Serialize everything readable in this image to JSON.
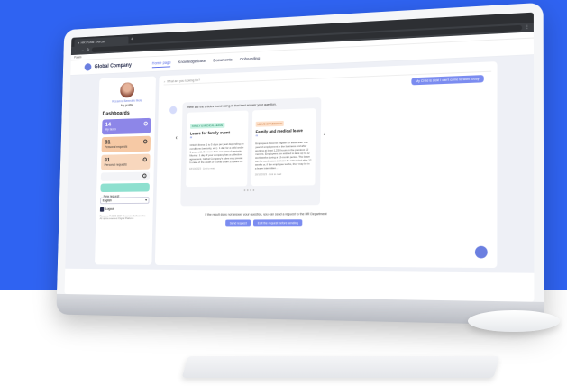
{
  "browser": {
    "tab_title": "HR Portal - Aircall",
    "url": "",
    "bookmarks_label": "Pages"
  },
  "header": {
    "company": "Global Company",
    "nav": [
      "Home page",
      "Knowledge base",
      "Documents",
      "Onboarding"
    ]
  },
  "sidebar": {
    "user_name": "Rosanna Benedek Mele",
    "profile_link": "My profile",
    "dashboards_title": "Dashboards",
    "cards": [
      {
        "count": "14",
        "label": "My tasks"
      },
      {
        "count": "81",
        "label": "Personal requests"
      },
      {
        "count": "81",
        "label": "Personal requests"
      }
    ],
    "closed_label": "Closed",
    "new_request_label": "New request",
    "language": "English",
    "logout_label": "Logout",
    "footer": "Rosanna © 2023-2024 Recursive Software Inc. All rights reserved. Digital Platform"
  },
  "main": {
    "search_placeholder": "What are you looking for?",
    "user_message": "My Child is sick! I can't come to work today",
    "answer_intro": "Here are the articles found using AI that best answer your question.",
    "articles": [
      {
        "tag": "FAMILY & MEDICAL LEAVE",
        "title": "Leave for family event",
        "body": "Child's illness: 1 to 5 days per year depending on conditions (seniority, etc.). 1 day for a child under 1 years old, 3 if more than one year of seniority. Moving: 1 day. If your company has a collective agreement, Global Company's rules may prevail. In case of the death of a child under 25 years o...",
        "date": "18/10/2023 · Link to read"
      },
      {
        "tag": "LEAVE OF ABSENCE",
        "title": "Family and medical leave",
        "body": "Employees become eligible for leave after one year of employment in the business and after working at least 1,250 hours in the previous 12 months. Employees are entitled to take up to 12 workweeks during a 12-month period. The leave can be continuous and can be scheduled after 12 weeks or, if the employee works, they may be in a leave intermitten...",
        "date": "18/10/2023 · Link to read"
      }
    ],
    "pager_dots": "● ● ● ●",
    "not_answered_prompt": "If the result does not answer your question, you can send a request to the HR Department",
    "send_request_label": "Send request",
    "edit_request_label": "Edit the request before sending"
  }
}
